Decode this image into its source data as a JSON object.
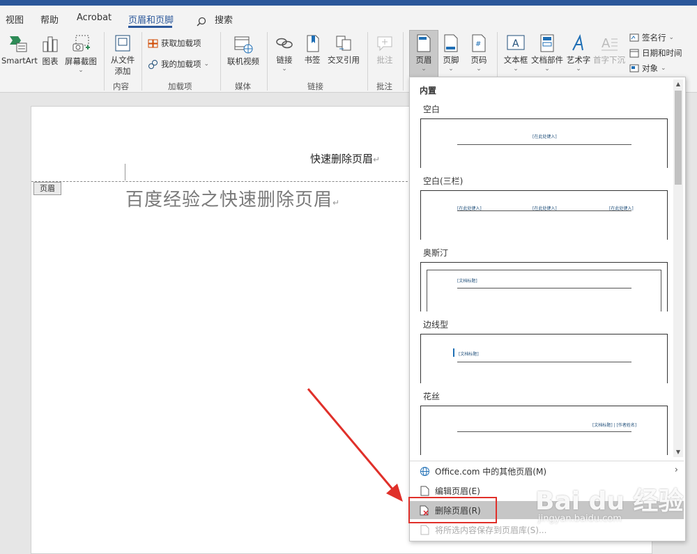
{
  "tabs": [
    {
      "label": "视图",
      "active": false
    },
    {
      "label": "帮助",
      "active": false
    },
    {
      "label": "Acrobat",
      "active": false
    },
    {
      "label": "页眉和页脚",
      "active": true
    }
  ],
  "search": {
    "label": "搜索"
  },
  "ribbon": {
    "illustrations": {
      "smartart": "SmartArt",
      "chart": "图表",
      "screenshot": "屏幕截图"
    },
    "content": {
      "from_file_1": "从文件",
      "from_file_2": "添加",
      "group": "内容"
    },
    "addins": {
      "get": "获取加载项",
      "my": "我的加载项",
      "group": "加载项"
    },
    "media": {
      "online_video": "联机视频",
      "group": "媒体"
    },
    "links": {
      "link": "链接",
      "bookmark": "书签",
      "cross_ref": "交叉引用",
      "group": "链接"
    },
    "comments": {
      "comment": "批注",
      "group": "批注"
    },
    "header_footer": {
      "header": "页眉",
      "footer": "页脚",
      "page_number": "页码"
    },
    "text": {
      "textbox": "文本框",
      "quick_parts": "文档部件",
      "wordart": "艺术字",
      "dropcap": "首字下沉",
      "signature": "签名行",
      "datetime": "日期和时间",
      "object": "对象"
    }
  },
  "document": {
    "header_text": "快速删除页眉",
    "header_tag": "页眉",
    "body_title": "百度经验之快速删除页眉",
    "return_mark": "↵"
  },
  "gallery": {
    "section": "内置",
    "items": [
      {
        "label": "空白",
        "placeholders": [
          "[在此处键入]"
        ]
      },
      {
        "label": "空白(三栏)",
        "placeholders": [
          "[在此处键入]",
          "[在此处键入]",
          "[在此处键入]"
        ]
      },
      {
        "label": "奥斯汀",
        "placeholders": [
          "[文档标题]"
        ]
      },
      {
        "label": "边线型",
        "placeholders": [
          "[文档标题]"
        ]
      },
      {
        "label": "花丝",
        "placeholders": [
          "[文档标题] | [作者姓名]"
        ]
      }
    ],
    "menu": {
      "more_online": "Office.com 中的其他页眉(M)",
      "edit": "编辑页眉(E)",
      "remove": "删除页眉(R)",
      "save_selection": "将所选内容保存到页眉库(S)..."
    }
  },
  "watermark": {
    "brand": "Bai du 经验",
    "url": "jingyan.baidu.com"
  },
  "colors": {
    "accent": "#2b579a",
    "highlight": "#e0302a",
    "arrow": "#e0302a"
  }
}
